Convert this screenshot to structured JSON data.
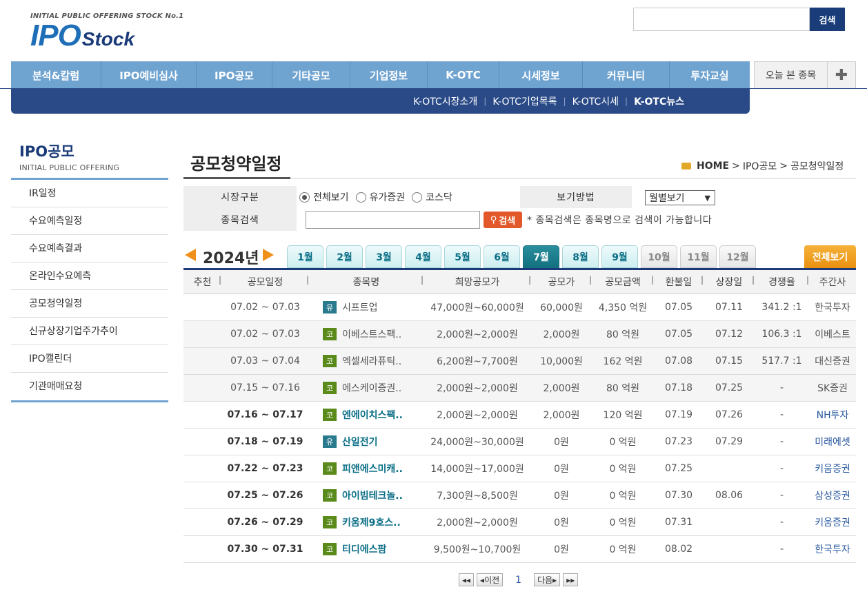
{
  "logo": {
    "tagline": "INITIAL PUBLIC OFFERING STOCK No.1",
    "ipo": "IPO",
    "stock": "Stock"
  },
  "header": {
    "search_button": "검색"
  },
  "nav": [
    "분석&칼럼",
    "IPO예비심사",
    "IPO공모",
    "기타공모",
    "기업정보",
    "K-OTC",
    "시세정보",
    "커뮤니티",
    "투자교실"
  ],
  "today": {
    "label": "오늘 본 종목",
    "plus": "✚"
  },
  "subnav": [
    "K-OTC시장소개",
    "K-OTC기업목록",
    "K-OTC시세",
    "K-OTC뉴스"
  ],
  "side": {
    "title": "IPO공모",
    "subtitle": "INITIAL PUBLIC OFFERING",
    "items": [
      "IR일정",
      "수요예측일정",
      "수요예측결과",
      "온라인수요예측",
      "공모청약일정",
      "신규상장기업주가추이",
      "IPO캘린더",
      "기관매매요청"
    ]
  },
  "page": {
    "title": "공모청약일정"
  },
  "breadcrumb": {
    "home": "HOME",
    "sep": ">",
    "level1": "IPO공모",
    "level2": "공모청약일정"
  },
  "filter": {
    "market_label": "시장구분",
    "radios": [
      "전체보기",
      "유가증권",
      "코스닥"
    ],
    "view_label": "보기방법",
    "view_value": "월별보기",
    "search_label": "종목검색",
    "search_button": "검색",
    "search_hint": "* 종목검색은 종목명으로 검색이 가능합니다"
  },
  "year": "2024년",
  "months": [
    "1월",
    "2월",
    "3월",
    "4월",
    "5월",
    "6월",
    "7월",
    "8월",
    "9월",
    "10월",
    "11월",
    "12월"
  ],
  "all_button": "전체보기",
  "columns": [
    "추천",
    "공모일정",
    "종목명",
    "희망공모가",
    "공모가",
    "공모금액",
    "환불일",
    "상장일",
    "경쟁율",
    "주간사"
  ],
  "rows": [
    {
      "schedule": "07.02 ~ 07.03",
      "market": "유",
      "name": "시프트업",
      "hope": "47,000원~60,000원",
      "price": "60,000원",
      "amount": "4,350 억원",
      "refund": "07.05",
      "listing": "07.11",
      "ratio": "341.2 :1",
      "broker": "한국투자"
    },
    {
      "schedule": "07.02 ~ 07.03",
      "market": "코",
      "name": "이베스트스팩..",
      "hope": "2,000원~2,000원",
      "price": "2,000원",
      "amount": "80 억원",
      "refund": "07.05",
      "listing": "07.12",
      "ratio": "106.3 :1",
      "broker": "이베스트"
    },
    {
      "schedule": "07.03 ~ 07.04",
      "market": "코",
      "name": "엑셀세라퓨틱..",
      "hope": "6,200원~7,700원",
      "price": "10,000원",
      "amount": "162 억원",
      "refund": "07.08",
      "listing": "07.15",
      "ratio": "517.7 :1",
      "broker": "대신증권"
    },
    {
      "schedule": "07.15 ~ 07.16",
      "market": "코",
      "name": "에스케이증권..",
      "hope": "2,000원~2,000원",
      "price": "2,000원",
      "amount": "80 억원",
      "refund": "07.18",
      "listing": "07.25",
      "ratio": "-",
      "broker": "SK증권"
    },
    {
      "schedule": "07.16 ~ 07.17",
      "market": "코",
      "name": "엔에이치스팩..",
      "hope": "2,000원~2,000원",
      "price": "2,000원",
      "amount": "120 억원",
      "refund": "07.19",
      "listing": "07.26",
      "ratio": "-",
      "broker": "NH투자"
    },
    {
      "schedule": "07.18 ~ 07.19",
      "market": "유",
      "name": "산일전기",
      "hope": "24,000원~30,000원",
      "price": "0원",
      "amount": "0 억원",
      "refund": "07.23",
      "listing": "07.29",
      "ratio": "-",
      "broker": "미래에셋"
    },
    {
      "schedule": "07.22 ~ 07.23",
      "market": "코",
      "name": "피앤에스미캐..",
      "hope": "14,000원~17,000원",
      "price": "0원",
      "amount": "0 억원",
      "refund": "07.25",
      "listing": "",
      "ratio": "-",
      "broker": "키움증권"
    },
    {
      "schedule": "07.25 ~ 07.26",
      "market": "코",
      "name": "아이빔테크놀..",
      "hope": "7,300원~8,500원",
      "price": "0원",
      "amount": "0 억원",
      "refund": "07.30",
      "listing": "08.06",
      "ratio": "-",
      "broker": "삼성증권"
    },
    {
      "schedule": "07.26 ~ 07.29",
      "market": "코",
      "name": "키움제9호스..",
      "hope": "2,000원~2,000원",
      "price": "0원",
      "amount": "0 억원",
      "refund": "07.31",
      "listing": "",
      "ratio": "-",
      "broker": "키움증권"
    },
    {
      "schedule": "07.30 ~ 07.31",
      "market": "코",
      "name": "티디에스팜",
      "hope": "9,500원~10,700원",
      "price": "0원",
      "amount": "0 억원",
      "refund": "08.02",
      "listing": "",
      "ratio": "-",
      "broker": "한국투자"
    }
  ],
  "pager": {
    "first": "◂◂",
    "prev": "◂이전",
    "page": "1",
    "next": "다음▸",
    "last": "▸▸"
  }
}
